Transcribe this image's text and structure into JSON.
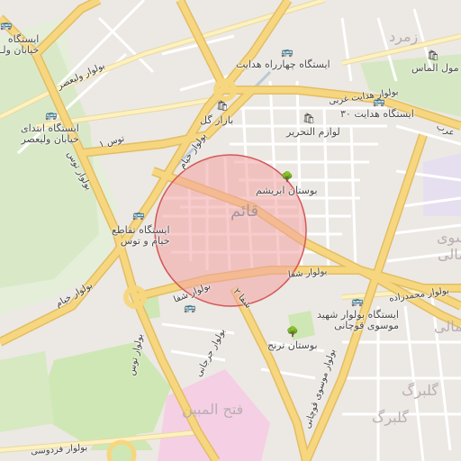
{
  "colors": {
    "background": "#ece8e3",
    "primary_road": "#f6d77f",
    "primary_road_casing": "#e3bd63",
    "secondary_road": "#fdf1bf",
    "minor_road": "#ffffff",
    "park": "#cfe7b4",
    "campus": "#f5cfe4",
    "rail": "#b7c9d9",
    "highlight_fill": "#f2a3a3",
    "highlight_stroke": "#d45858"
  },
  "labels": {
    "station_khiaban_valiasr_top": "ایستگاه\nخیابان ولـ",
    "boulevard_valiasr": "بولوار ولیعصر",
    "station_charrah_hedayat": "ایستگاه چهارراه هدایت",
    "zomorod": "زمرد",
    "almas_mall": "مول الماس",
    "boulevard_hedayat": "بولوار هدایت غربی",
    "station_hedayat_30": "ایستگاه هدایت ۳۰",
    "bazaar_gol": "بازار گل",
    "lavazem_tahrir": "لوازم التحریر",
    "school_valiasr": "ایستگاه ابتدای\nخیابان ولیعصر",
    "toos_1": "توس ۱",
    "boulevard_toos_left": "بولوار توس",
    "khayyam_top": "بولوار خیام",
    "bustan_abrisham": "بوستان ابریشم",
    "ghaem": "قائم",
    "station_taghato": "ایستگاه تقاطع\nخیام و توس",
    "boulevard_khayyam_left": "بولوار خیام",
    "boulevard_shafa": "بولوار شفا",
    "shafa_road": "بولوار شفا",
    "shafa_2": "شفا ۲",
    "mohammadzadeh": "بولوار محمدزاده",
    "station_foojani": "ایستگاه بولوار شهید\nموسوی قوچانی",
    "bustan_toranj": "بوستان ترنج",
    "toos_vertical": "بولوار توس",
    "jorjani": "بولوار جرجانی",
    "foojani": "بولوار موسوی قوچانی",
    "golbarg": "گلبرگ",
    "golbarg_2": "گلبرگ",
    "fath_al_mobin": "فتح المبین",
    "ferdowsi": "بولوار فردوسی",
    "mousavi_right": "موسوی",
    "jamali": "جمالی",
    "jamali_2": "جمالی",
    "arab_right": "عرب"
  },
  "icons": {
    "bus": "bus-stop-icon",
    "shop": "shopping-bag-icon",
    "park": "park-tree-icon"
  }
}
